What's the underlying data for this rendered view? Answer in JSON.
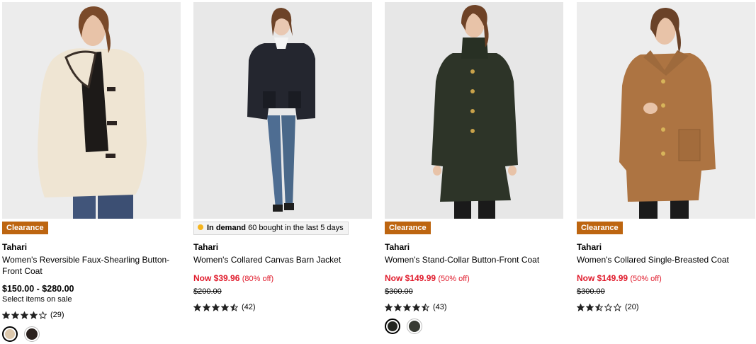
{
  "products": [
    {
      "badge": {
        "type": "clearance",
        "label": "Clearance"
      },
      "brand": "Tahari",
      "name": "Women's Reversible Faux-Shearling Button-Front Coat",
      "price_range": "$150.00 - $280.00",
      "price_note": "Select items on sale",
      "rating": 4,
      "review_count": "(29)",
      "swatches": [
        {
          "color": "#ddc9ad",
          "selected": true
        },
        {
          "color": "#2a211e",
          "selected": false
        }
      ],
      "image_bg": "#ececec",
      "coat_color": "#efe5d3"
    },
    {
      "badge": {
        "type": "demand",
        "strong": "In demand",
        "label": "60 bought in the last 5 days"
      },
      "brand": "Tahari",
      "name": "Women's Collared Canvas Barn Jacket",
      "sale_price": "Now $39.96",
      "sale_pct": "(80% off)",
      "orig_price": "$200.00",
      "rating": 4.5,
      "review_count": "(42)",
      "swatches": [],
      "image_bg": "#e8e8e8",
      "coat_color": "#24262f"
    },
    {
      "badge": {
        "type": "clearance",
        "label": "Clearance"
      },
      "brand": "Tahari",
      "name": "Women's Stand-Collar Button-Front Coat",
      "sale_price": "Now $149.99",
      "sale_pct": "(50% off)",
      "orig_price": "$300.00",
      "rating": 4.5,
      "review_count": "(43)",
      "swatches": [
        {
          "color": "#232520",
          "selected": true
        },
        {
          "color": "#373a33",
          "selected": false
        }
      ],
      "image_bg": "#e7e7e7",
      "coat_color": "#2d3428"
    },
    {
      "badge": {
        "type": "clearance",
        "label": "Clearance"
      },
      "brand": "Tahari",
      "name": "Women's Collared Single-Breasted Coat",
      "sale_price": "Now $149.99",
      "sale_pct": "(50% off)",
      "orig_price": "$300.00",
      "rating": 2.5,
      "review_count": "(20)",
      "swatches": [],
      "image_bg": "#ededed",
      "coat_color": "#ad7442"
    }
  ],
  "colors": {
    "clearance": "#bd6510",
    "sale_red": "#e01a2b",
    "demand_dot": "#f6b51e"
  }
}
